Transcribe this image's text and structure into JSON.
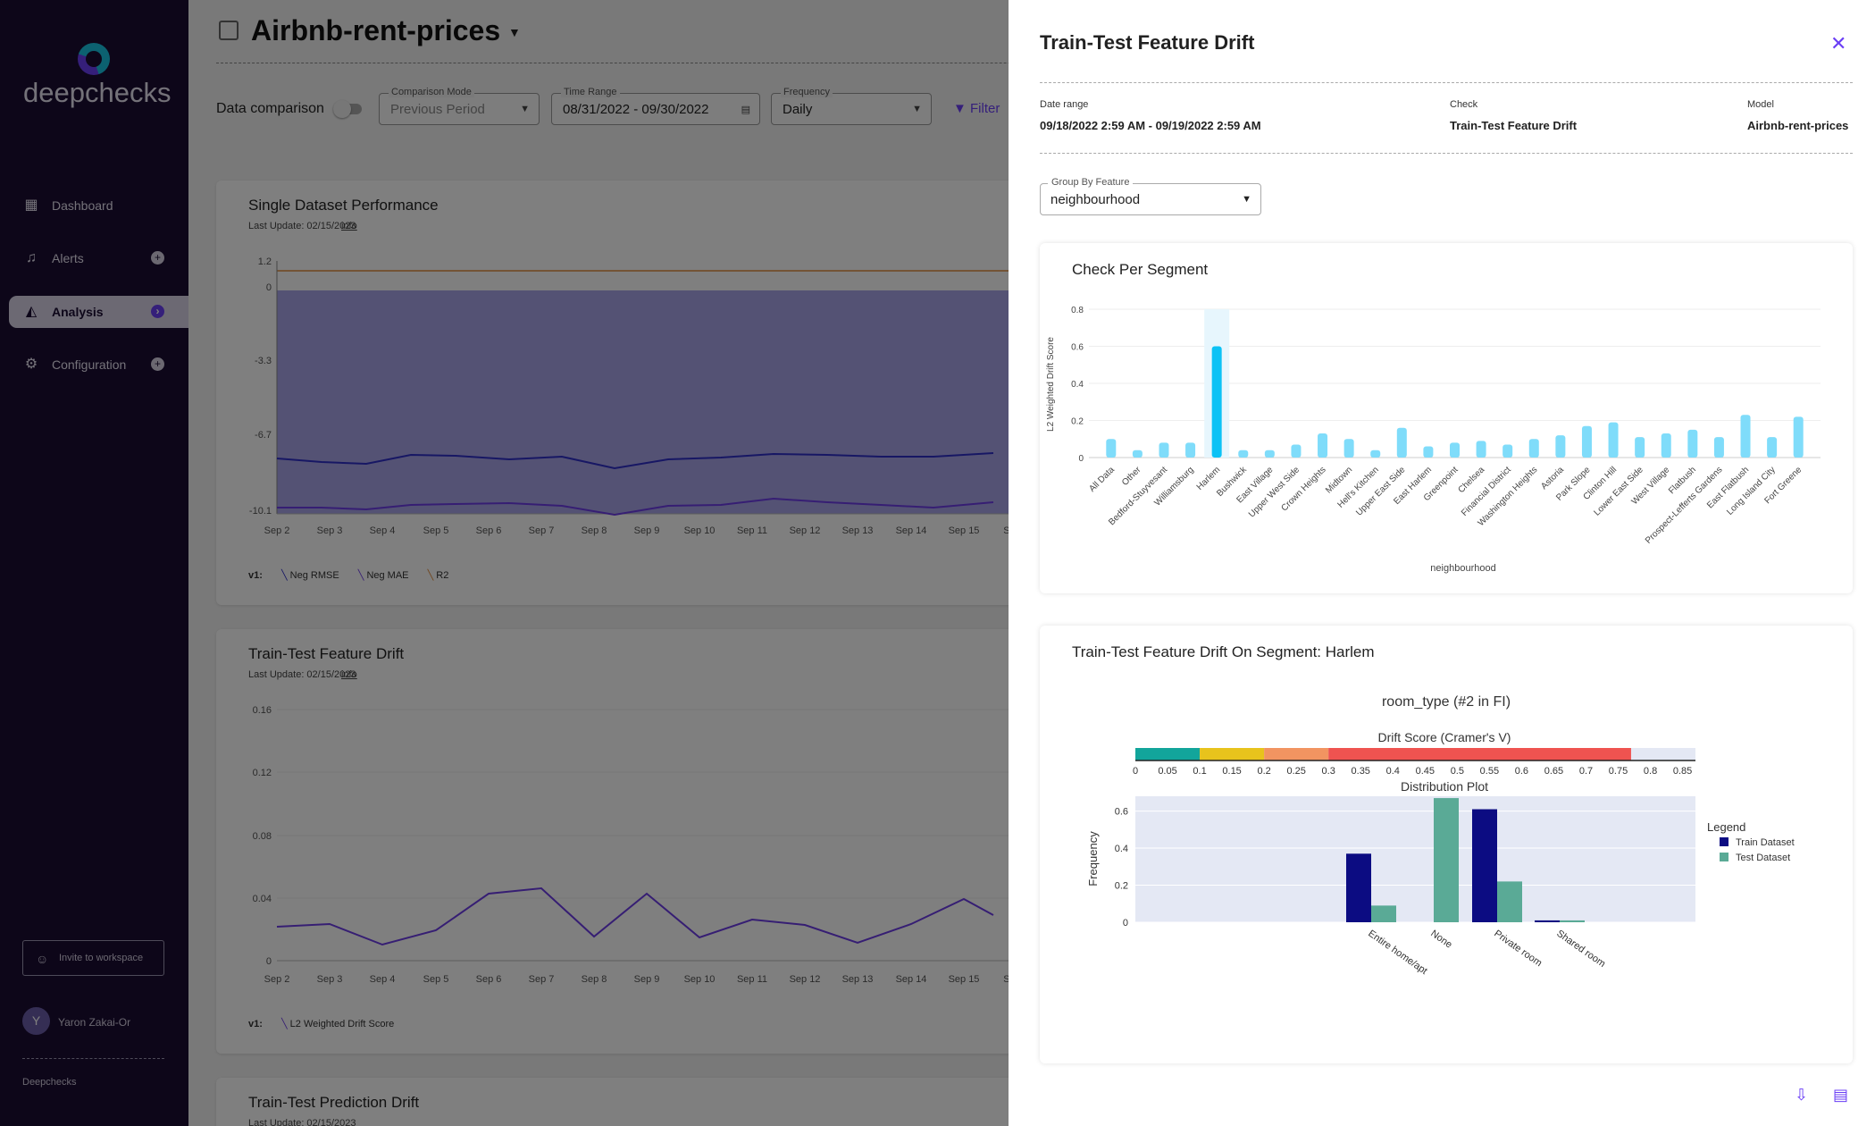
{
  "sidebar": {
    "logo_text": "deepchecks",
    "nav": [
      {
        "label": "Dashboard",
        "icon": "dashboard-icon"
      },
      {
        "label": "Alerts",
        "icon": "bell-icon"
      },
      {
        "label": "Analysis",
        "icon": "analysis-icon"
      },
      {
        "label": "Configuration",
        "icon": "gear-icon"
      }
    ],
    "invite_label": "Invite to workspace",
    "user_initial": "Y",
    "user_name": "Yaron Zakai-Or",
    "company": "Deepchecks"
  },
  "header": {
    "model_name": "Airbnb-rent-prices",
    "data_comparison_label": "Data comparison",
    "comparison_mode": {
      "label": "Comparison Mode",
      "value": "Previous Period"
    },
    "time_range": {
      "label": "Time Range",
      "value": "08/31/2022 - 09/30/2022"
    },
    "frequency": {
      "label": "Frequency",
      "value": "Daily"
    },
    "filter_label": "Filter"
  },
  "cards": [
    {
      "title": "Single Dataset Performance",
      "last_update": "Last Update: 02/15/2023",
      "info": "info",
      "y_ticks": [
        "1.2",
        "0",
        "-3.3",
        "-6.7",
        "-10.1"
      ],
      "x_ticks": [
        "Sep 2",
        "Sep 3",
        "Sep 4",
        "Sep 5",
        "Sep 6",
        "Sep 7",
        "Sep 8",
        "Sep 9",
        "Sep 10",
        "Sep 11",
        "Sep 12",
        "Sep 13",
        "Sep 14",
        "Sep 15",
        "Se"
      ],
      "legend_prefix": "v1:",
      "legend": [
        "Neg RMSE",
        "Neg MAE",
        "R2"
      ]
    },
    {
      "title": "Train-Test Feature Drift",
      "last_update": "Last Update: 02/15/2023",
      "info": "info",
      "y_ticks": [
        "0.16",
        "0.12",
        "0.08",
        "0.04",
        "0"
      ],
      "x_ticks": [
        "Sep 2",
        "Sep 3",
        "Sep 4",
        "Sep 5",
        "Sep 6",
        "Sep 7",
        "Sep 8",
        "Sep 9",
        "Sep 10",
        "Sep 11",
        "Sep 12",
        "Sep 13",
        "Sep 14",
        "Sep 15",
        "Se"
      ],
      "legend_prefix": "v1:",
      "legend": [
        "L2 Weighted Drift Score"
      ]
    },
    {
      "title": "Train-Test Prediction Drift",
      "last_update": "Last Update: 02/15/2023"
    }
  ],
  "drawer": {
    "title": "Train-Test Feature Drift",
    "date_range_label": "Date range",
    "date_range_value": "09/18/2022 2:59 AM - 09/19/2022 2:59 AM",
    "check_label": "Check",
    "check_value": "Train-Test Feature Drift",
    "model_label": "Model",
    "model_value": "Airbnb-rent-prices",
    "group_by_label": "Group By Feature",
    "group_by_value": "neighbourhood",
    "segment_panel_title": "Check Per Segment",
    "drift_panel_title": "Train-Test Feature Drift On Segment: Harlem",
    "feature_title": "room_type (#2 in FI)",
    "drift_score_title": "Drift Score (Cramer's V)",
    "distribution_title": "Distribution Plot",
    "legend_title": "Legend"
  },
  "chart_data": [
    {
      "type": "bar",
      "title": "Check Per Segment",
      "xlabel": "neighbourhood",
      "ylabel": "L2 Weighted Drift Score",
      "ylim": [
        0,
        0.8
      ],
      "y_ticks": [
        0,
        0.2,
        0.4,
        0.6,
        0.8
      ],
      "highlighted": "Harlem",
      "color": "#7fdcfa",
      "highlight_color": "#0cc2f5",
      "categories": [
        "All Data",
        "Other",
        "Bedford-Stuyvesant",
        "Williamsburg",
        "Harlem",
        "Bushwick",
        "East Village",
        "Upper West Side",
        "Crown Heights",
        "Midtown",
        "Hell's Kitchen",
        "Upper East Side",
        "East Harlem",
        "Greenpoint",
        "Chelsea",
        "Financial District",
        "Washington Heights",
        "Astoria",
        "Park Slope",
        "Clinton Hill",
        "Lower East Side",
        "West Village",
        "Flatbush",
        "Prospect-Lefferts Gardens",
        "East Flatbush",
        "Long Island City",
        "Fort Greene"
      ],
      "values": [
        0.1,
        0.04,
        0.08,
        0.08,
        0.6,
        0.04,
        0.04,
        0.07,
        0.13,
        0.1,
        0.04,
        0.16,
        0.06,
        0.08,
        0.09,
        0.07,
        0.1,
        0.12,
        0.17,
        0.19,
        0.11,
        0.13,
        0.15,
        0.11,
        0.23,
        0.11,
        0.22
      ]
    },
    {
      "type": "bar",
      "title": "Drift Score (Cramer's V)",
      "xlim": [
        0,
        0.87
      ],
      "x_ticks": [
        "0",
        "0.05",
        "0.1",
        "0.15",
        "0.2",
        "0.25",
        "0.3",
        "0.35",
        "0.4",
        "0.45",
        "0.5",
        "0.55",
        "0.6",
        "0.65",
        "0.7",
        "0.75",
        "0.8",
        "0.85"
      ],
      "value": 0.77,
      "segments": [
        {
          "from": 0,
          "to": 0.1,
          "color": "#12a59b"
        },
        {
          "from": 0.1,
          "to": 0.2,
          "color": "#e8c31c"
        },
        {
          "from": 0.2,
          "to": 0.3,
          "color": "#f29461"
        },
        {
          "from": 0.3,
          "to": 0.77,
          "color": "#ef5350"
        }
      ]
    },
    {
      "type": "bar",
      "title": "Distribution Plot",
      "ylabel": "Frequency",
      "ylim": [
        0,
        0.68
      ],
      "y_ticks": [
        "0",
        "0.2",
        "0.4",
        "0.6"
      ],
      "categories": [
        "Entire home/apt",
        "None",
        "Private room",
        "Shared room"
      ],
      "series": [
        {
          "name": "Train Dataset",
          "color": "#0c0c82",
          "values": [
            0.37,
            0,
            0.61,
            0.01
          ]
        },
        {
          "name": "Test Dataset",
          "color": "#5aaa96",
          "values": [
            0.09,
            0.67,
            0.22,
            0.01
          ]
        }
      ]
    }
  ]
}
